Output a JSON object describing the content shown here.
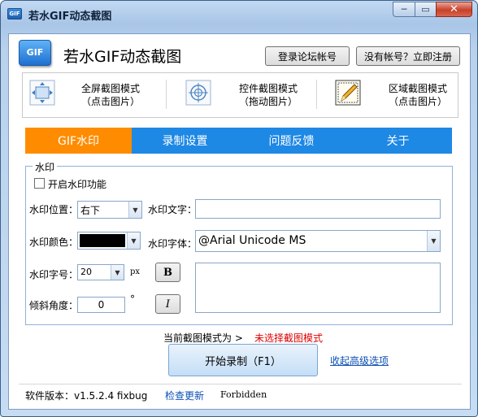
{
  "window": {
    "title": "若水GIF动态截图",
    "title_icon": "GIF",
    "buttons": {
      "minimize": "─",
      "maximize": "▭",
      "close": "✕"
    }
  },
  "header": {
    "logo_text": "GIF",
    "app_name": "若水GIF动态截图",
    "login_button": "登录论坛帐号",
    "register_button": "没有帐号？立即注册"
  },
  "modes": [
    {
      "title": "全屏截图模式",
      "sub": "（点击图片）",
      "icon": "fullscreen-capture-icon"
    },
    {
      "title": "控件截图模式",
      "sub": "（拖动图片）",
      "icon": "crosshair-target-icon"
    },
    {
      "title": "区域截图模式",
      "sub": "（点击图片）",
      "icon": "pencil-region-icon"
    }
  ],
  "tabs": [
    {
      "label": "GIF水印",
      "active": true
    },
    {
      "label": "录制设置",
      "active": false
    },
    {
      "label": "问题反馈",
      "active": false
    },
    {
      "label": "关于",
      "active": false
    }
  ],
  "watermark": {
    "group_title": "水印",
    "enable_label": "开启水印功能",
    "enable_checked": false,
    "position_label": "水印位置：",
    "position_value": "右下",
    "text_label": "水印文字：",
    "text_value": "",
    "color_label": "水印颜色：",
    "color_value": "#000000",
    "font_label": "水印字体：",
    "font_value": "@Arial Unicode MS",
    "size_label": "水印字号：",
    "size_value": "20",
    "size_unit": "px",
    "bold_label": "B",
    "tilt_label": "倾斜角度：",
    "tilt_value": "0",
    "tilt_unit": "°",
    "italic_label": "I"
  },
  "status": {
    "prefix": "当前截图模式为  >",
    "value": "未选择截图模式",
    "value_color": "#e00000"
  },
  "actions": {
    "start_button": "开始录制（F1）",
    "advanced_link": "收起高级选项"
  },
  "footer": {
    "version": "软件版本：v1.5.2.4 fixbug",
    "update_link": "检查更新",
    "forbidden": "Forbidden"
  },
  "colors": {
    "tab_active": "#ff8c00",
    "tab_bar": "#1e88e5",
    "link": "#0a4fb4"
  }
}
